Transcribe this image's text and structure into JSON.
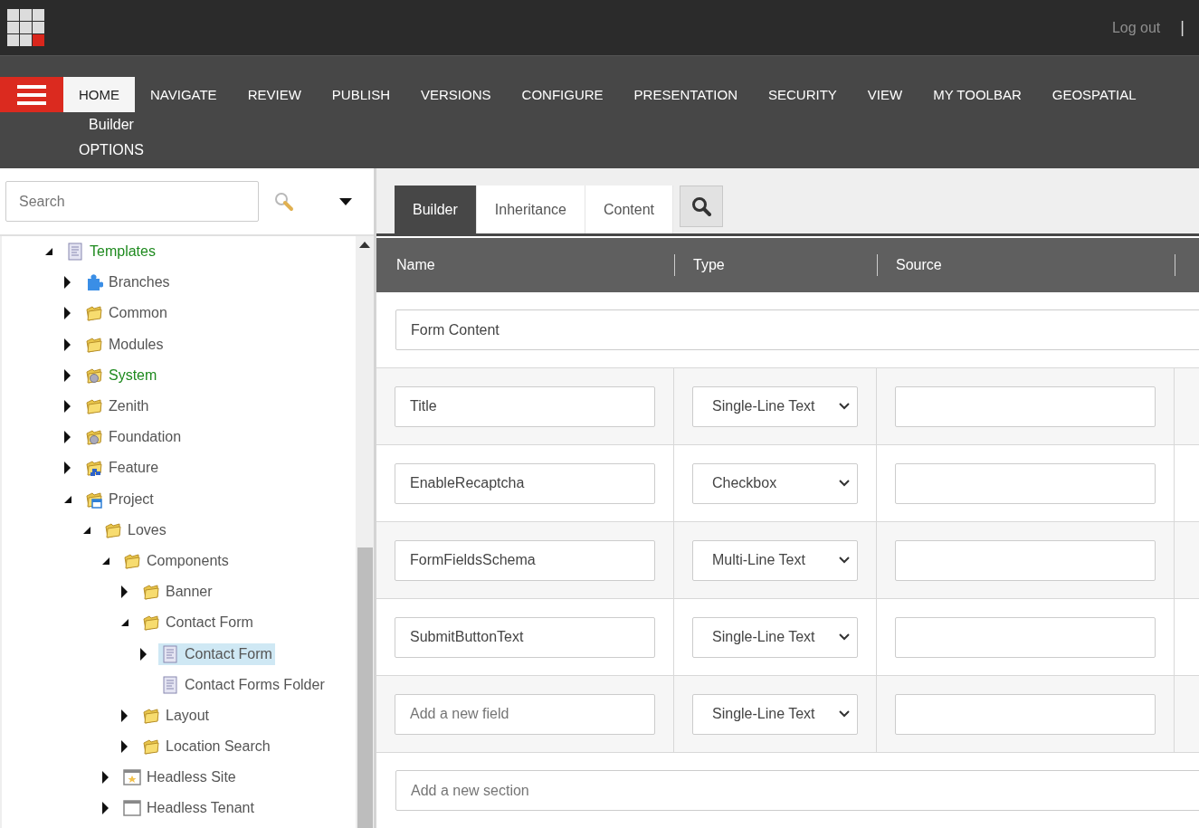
{
  "topbar": {
    "logout": "Log out",
    "separator": "|"
  },
  "ribbon": {
    "tabs": [
      {
        "label": "HOME",
        "selected": true
      },
      {
        "label": "NAVIGATE",
        "selected": false
      },
      {
        "label": "REVIEW",
        "selected": false
      },
      {
        "label": "PUBLISH",
        "selected": false
      },
      {
        "label": "VERSIONS",
        "selected": false
      },
      {
        "label": "CONFIGURE",
        "selected": false
      },
      {
        "label": "PRESENTATION",
        "selected": false
      },
      {
        "label": "SECURITY",
        "selected": false
      },
      {
        "label": "VIEW",
        "selected": false
      },
      {
        "label": "MY TOOLBAR",
        "selected": false
      },
      {
        "label": "GEOSPATIAL",
        "selected": false
      }
    ],
    "groups": [
      "Builder",
      "OPTIONS"
    ]
  },
  "sidebar": {
    "search": {
      "placeholder": "Search"
    },
    "tree": [
      {
        "label": "Templates",
        "kind": "template",
        "color": "#1e8a1e",
        "expandable": true,
        "expanded": true,
        "selected": false,
        "children": [
          {
            "label": "Branches",
            "kind": "puzzle",
            "color": "#555555",
            "expandable": true,
            "expanded": false,
            "selected": false
          },
          {
            "label": "Common",
            "kind": "folder",
            "color": "#555555",
            "expandable": true,
            "expanded": false,
            "selected": false
          },
          {
            "label": "Modules",
            "kind": "folder",
            "color": "#555555",
            "expandable": true,
            "expanded": false,
            "selected": false
          },
          {
            "label": "System",
            "kind": "folder-gear",
            "color": "#1e8a1e",
            "expandable": true,
            "expanded": false,
            "selected": false
          },
          {
            "label": "Zenith",
            "kind": "folder",
            "color": "#555555",
            "expandable": true,
            "expanded": false,
            "selected": false
          },
          {
            "label": "Foundation",
            "kind": "folder-gear",
            "color": "#555555",
            "expandable": true,
            "expanded": false,
            "selected": false
          },
          {
            "label": "Feature",
            "kind": "folder-blocks",
            "color": "#555555",
            "expandable": true,
            "expanded": false,
            "selected": false
          },
          {
            "label": "Project",
            "kind": "folder-window",
            "color": "#555555",
            "expandable": true,
            "expanded": true,
            "selected": false,
            "children": [
              {
                "label": "Loves",
                "kind": "folder",
                "color": "#555555",
                "expandable": true,
                "expanded": true,
                "selected": false,
                "children": [
                  {
                    "label": "Components",
                    "kind": "folder",
                    "color": "#555555",
                    "expandable": true,
                    "expanded": true,
                    "selected": false,
                    "children": [
                      {
                        "label": "Banner",
                        "kind": "folder",
                        "color": "#555555",
                        "expandable": true,
                        "expanded": false,
                        "selected": false
                      },
                      {
                        "label": "Contact Form",
                        "kind": "folder",
                        "color": "#555555",
                        "expandable": true,
                        "expanded": true,
                        "selected": false,
                        "children": [
                          {
                            "label": "Contact Form",
                            "kind": "template",
                            "color": "#555555",
                            "expandable": true,
                            "expanded": false,
                            "selected": true
                          },
                          {
                            "label": "Contact Forms Folder",
                            "kind": "template",
                            "color": "#555555",
                            "expandable": false,
                            "selected": false
                          }
                        ]
                      },
                      {
                        "label": "Layout",
                        "kind": "folder",
                        "color": "#555555",
                        "expandable": true,
                        "expanded": false,
                        "selected": false
                      },
                      {
                        "label": "Location Search",
                        "kind": "folder",
                        "color": "#555555",
                        "expandable": true,
                        "expanded": false,
                        "selected": false
                      }
                    ]
                  },
                  {
                    "label": "Headless Site",
                    "kind": "site",
                    "color": "#555555",
                    "expandable": true,
                    "expanded": false,
                    "selected": false
                  },
                  {
                    "label": "Headless Tenant",
                    "kind": "window",
                    "color": "#555555",
                    "expandable": true,
                    "expanded": false,
                    "selected": false
                  }
                ]
              }
            ]
          }
        ]
      }
    ]
  },
  "editor": {
    "tabs": [
      {
        "label": "Builder",
        "selected": true
      },
      {
        "label": "Inheritance",
        "selected": false
      },
      {
        "label": "Content",
        "selected": false
      }
    ],
    "table": {
      "columns": [
        "Name",
        "Type",
        "Source"
      ],
      "rows": [
        {
          "kind": "section",
          "name": {
            "value": "Form Content"
          }
        },
        {
          "kind": "field",
          "name": {
            "value": "Title"
          },
          "type": "Single-Line Text"
        },
        {
          "kind": "field",
          "name": {
            "value": "EnableRecaptcha"
          },
          "type": "Checkbox"
        },
        {
          "kind": "field",
          "name": {
            "value": "FormFieldsSchema"
          },
          "type": "Multi-Line Text"
        },
        {
          "kind": "field",
          "name": {
            "value": "SubmitButtonText"
          },
          "type": "Single-Line Text"
        },
        {
          "kind": "field",
          "name": {
            "placeholder": "Add a new field"
          },
          "type": "Single-Line Text"
        },
        {
          "kind": "section",
          "name": {
            "placeholder": "Add a new section"
          }
        }
      ]
    }
  }
}
